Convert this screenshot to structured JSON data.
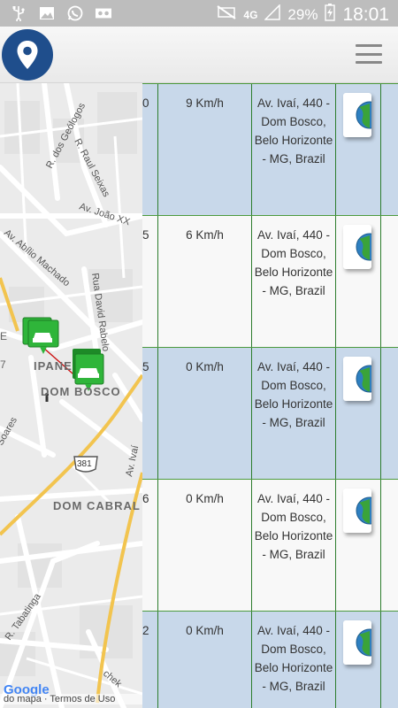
{
  "status_bar": {
    "network": "4G",
    "battery": "29%",
    "time": "18:01"
  },
  "map": {
    "labels": {
      "r_geologos": "R. dos Geólogos",
      "r_raul_seixas": "R. Raul Seixas",
      "av_joao": "Av. João XX",
      "av_abilio": "Av. Abílio Machado",
      "rua_david": "Rua David Rabelo",
      "ipanema": "IPANE",
      "dom_bosco": "DOM BOSCO",
      "soares": "Soares",
      "road_shield": "381",
      "av_ivai": "Av. Ivaí",
      "dom_cabral": "DOM CABRAL",
      "r_tabatinga": "R. Tabatinga",
      "r_chek": "chek",
      "side_e": "E",
      "side_7": "7"
    },
    "attribution": {
      "data": "do mapa",
      "terms": "Termos de Uso",
      "google": "Google"
    }
  },
  "table": {
    "rows": [
      {
        "id_tail": "0",
        "speed": "9 Km/h",
        "address": "Av. Ivaí, 440 - Dom Bosco, Belo Horizonte - MG, Brazil"
      },
      {
        "id_tail": "5",
        "speed": "6 Km/h",
        "address": "Av. Ivaí, 440 - Dom Bosco, Belo Horizonte - MG, Brazil"
      },
      {
        "id_tail": "5",
        "speed": "0 Km/h",
        "address": "Av. Ivaí, 440 - Dom Bosco, Belo Horizonte - MG, Brazil"
      },
      {
        "id_tail": "6",
        "speed": "0 Km/h",
        "address": "Av. Ivaí, 440 - Dom Bosco, Belo Horizonte - MG, Brazil"
      },
      {
        "id_tail": "2",
        "speed": "0 Km/h",
        "address": "Av. Ivaí, 440 - Dom Bosco, Belo Horizonte - MG, Brazil"
      }
    ]
  },
  "colors": {
    "row_blue": "#c8d8ea",
    "row_white": "#f8f8f8",
    "grid_green": "#2d7d2d",
    "marker_green": "#2fb53a",
    "logo_blue": "#1f4e8c"
  }
}
